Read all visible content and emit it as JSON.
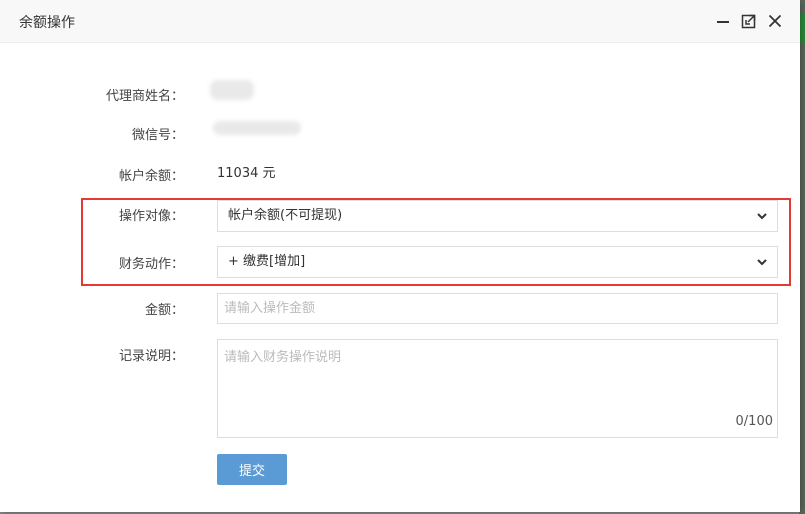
{
  "dialog": {
    "title": "余额操作"
  },
  "form": {
    "agent_name_label": "代理商姓名：",
    "wechat_label": "微信号：",
    "balance_label": "帐户余额：",
    "balance_value": "11034 元",
    "operation_target_label": "操作对像：",
    "operation_target_value": "帐户余额(不可提现)",
    "finance_action_label": "财务动作：",
    "finance_action_value": "+ 缴费[增加]",
    "amount_label": "金额：",
    "amount_placeholder": "请输入操作金额",
    "note_label": "记录说明：",
    "note_placeholder": "请输入财务操作说明",
    "note_counter": "0/100",
    "submit_label": "提交"
  },
  "icons": {
    "minimize": "minimize-icon",
    "maximize": "maximize-icon",
    "close": "close-icon",
    "dropdown": "chevron-down-icon"
  },
  "colors": {
    "submit_button": "#5b9bd5",
    "highlight_border": "#e53935"
  }
}
